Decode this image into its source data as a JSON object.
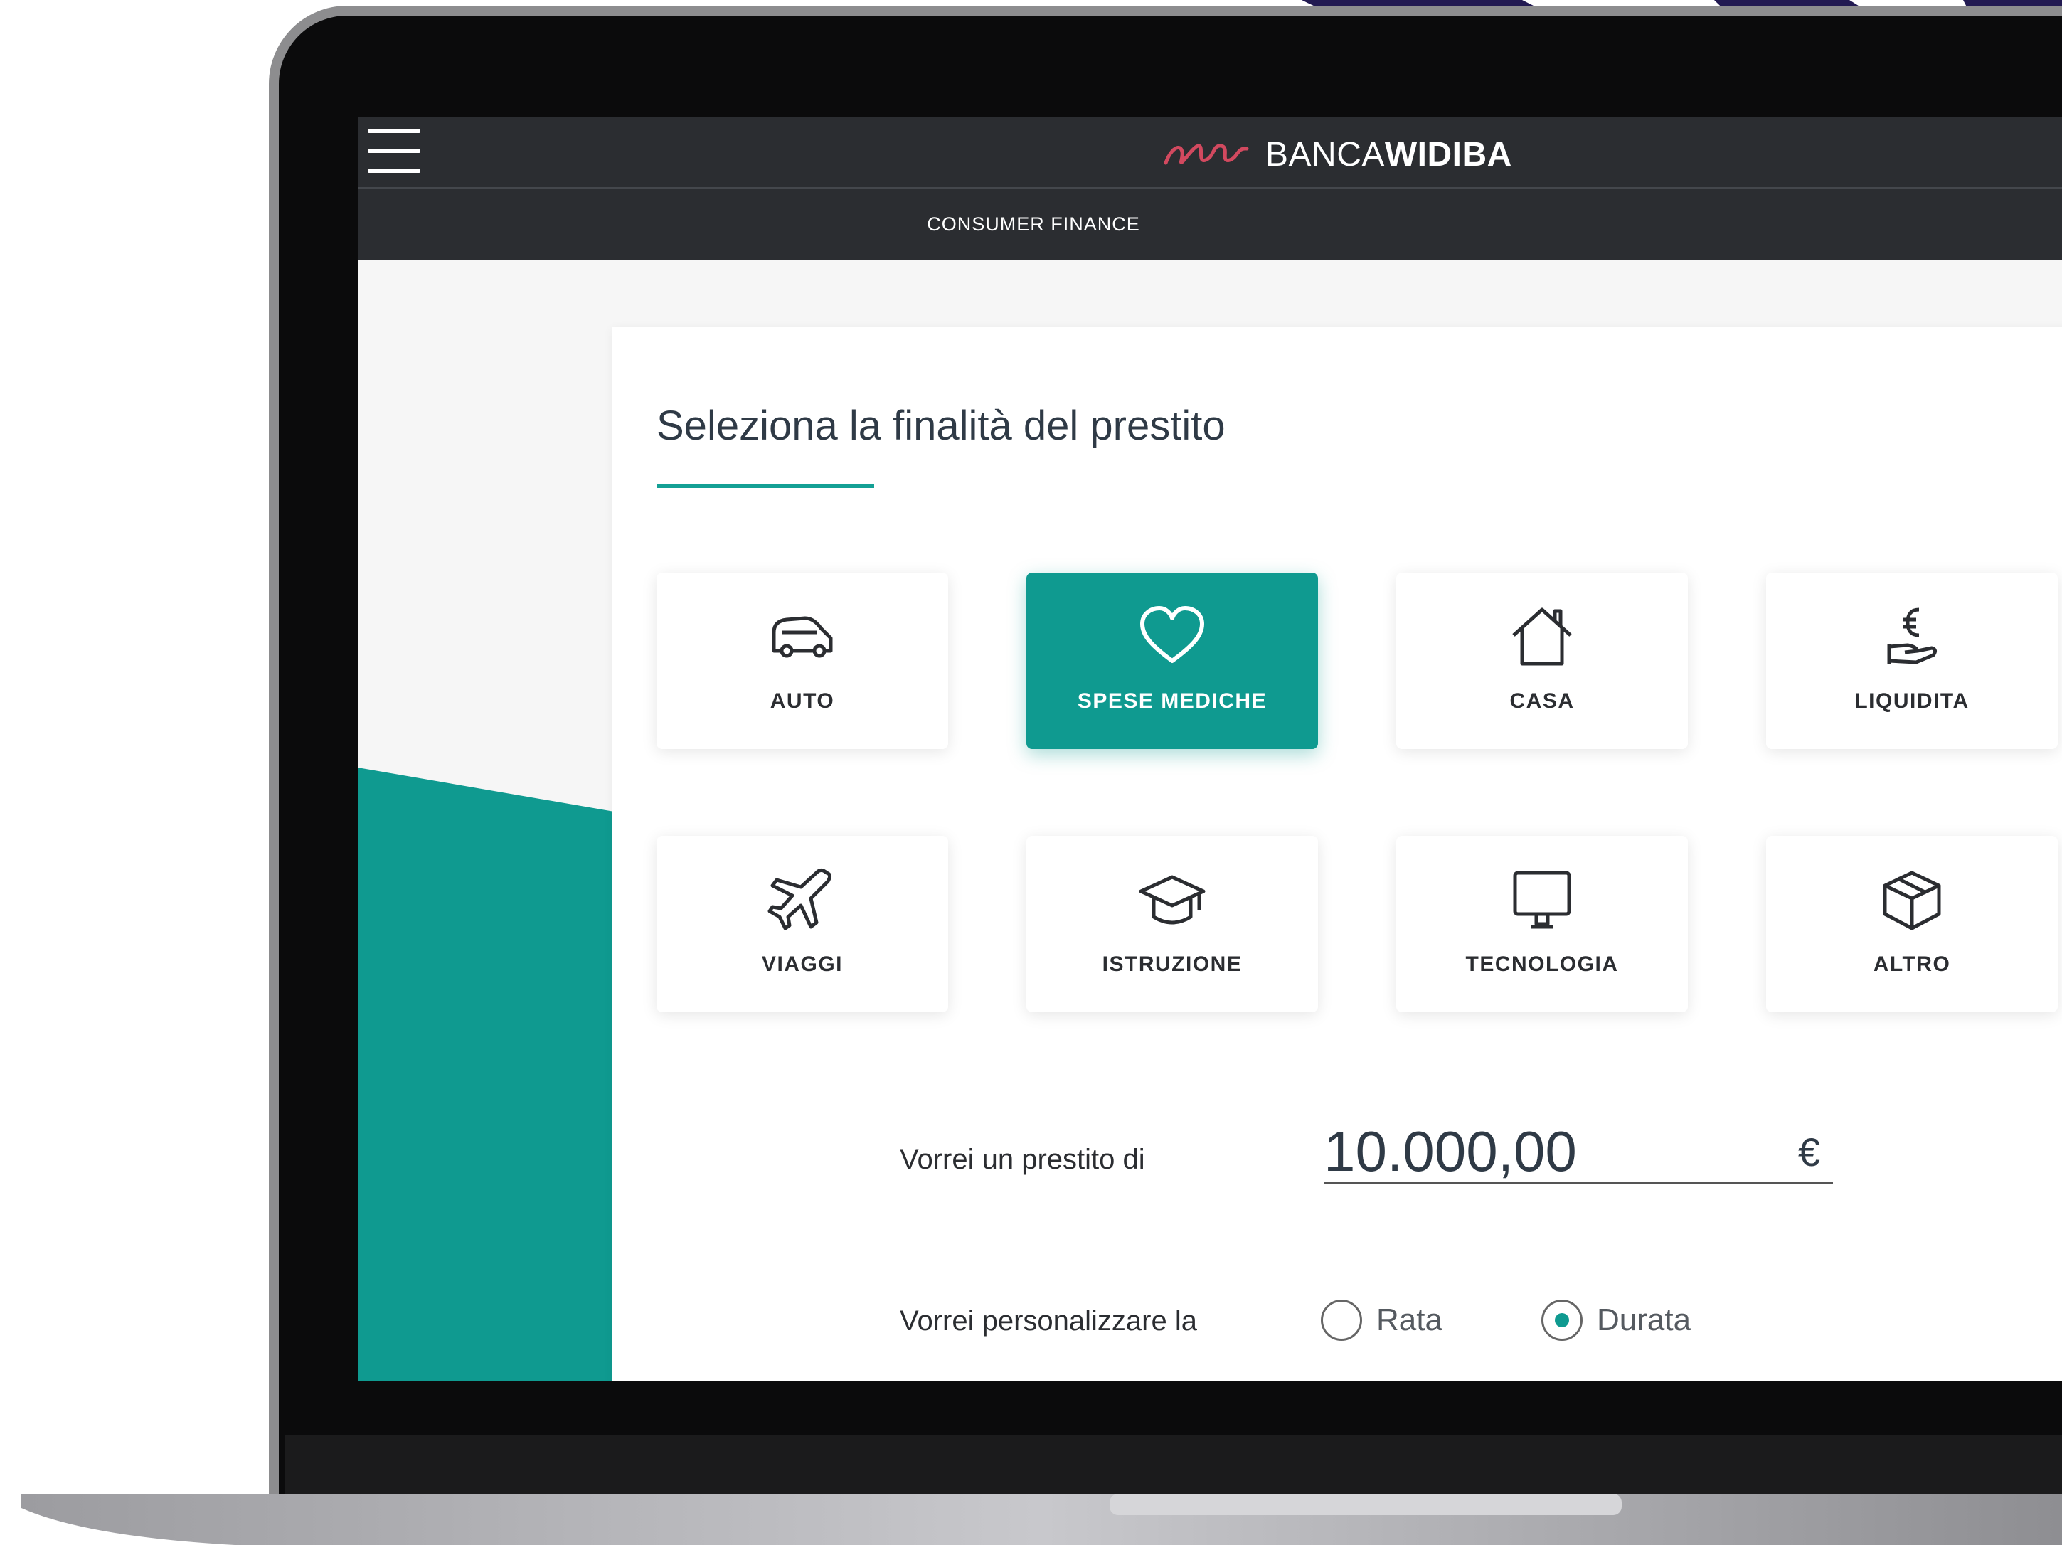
{
  "header": {
    "brand_prefix": "BANCA",
    "brand_bold": "WIDIBA",
    "subtitle": "CONSUMER FINANCE"
  },
  "main": {
    "title": "Seleziona la finalità del prestito",
    "purposes": [
      {
        "label": "AUTO",
        "icon": "car-icon",
        "selected": false
      },
      {
        "label": "SPESE MEDICHE",
        "icon": "heart-icon",
        "selected": true
      },
      {
        "label": "CASA",
        "icon": "house-icon",
        "selected": false
      },
      {
        "label": "LIQUIDITA",
        "icon": "euro-hand-icon",
        "selected": false
      },
      {
        "label": "VIAGGI",
        "icon": "airplane-icon",
        "selected": false
      },
      {
        "label": "ISTRUZIONE",
        "icon": "graduation-cap-icon",
        "selected": false
      },
      {
        "label": "TECNOLOGIA",
        "icon": "monitor-icon",
        "selected": false
      },
      {
        "label": "ALTRO",
        "icon": "box-icon",
        "selected": false
      }
    ],
    "loan_label": "Vorrei un prestito di",
    "loan_amount": "10.000,00",
    "currency": "€",
    "customize_label": "Vorrei personalizzare la",
    "options": [
      {
        "label": "Rata",
        "selected": false
      },
      {
        "label": "Durata",
        "selected": true
      }
    ]
  },
  "colors": {
    "accent": "#0f9a90",
    "header": "#2b2d31",
    "logo": "#d2495f",
    "waves": "#221a52"
  }
}
